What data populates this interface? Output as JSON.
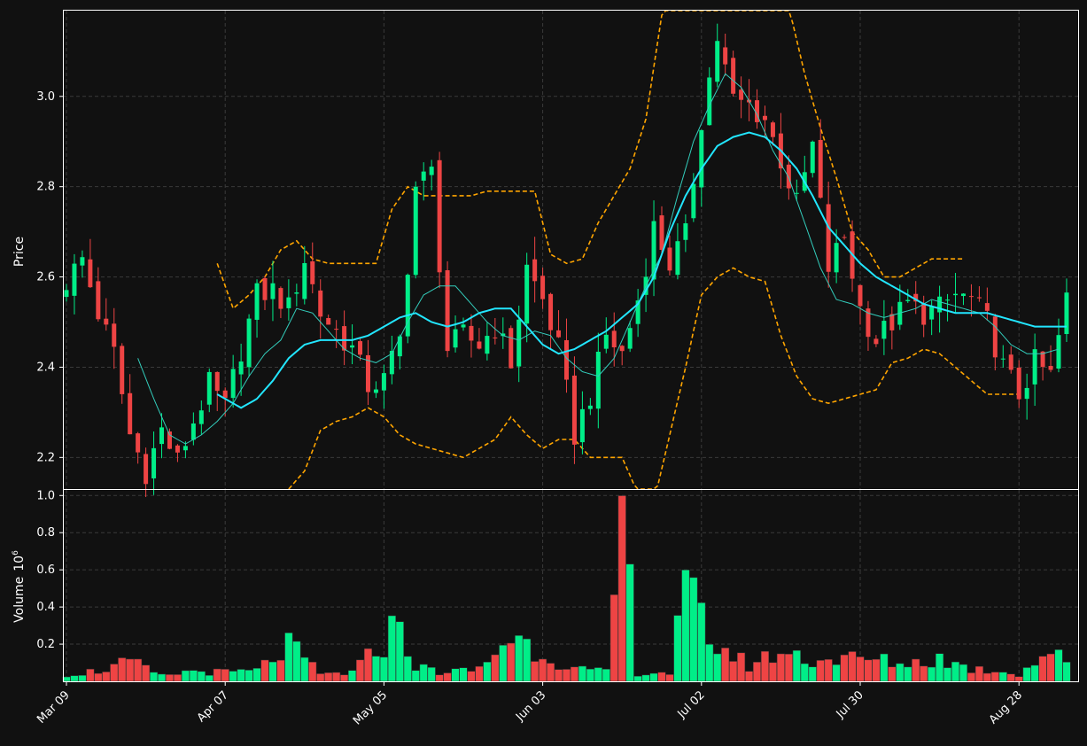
{
  "chart_data": {
    "type": "candlestick",
    "x_tick_labels": [
      "Mar 09",
      "Apr 07",
      "May 05",
      "Jun 03",
      "Jul 02",
      "Jul 30",
      "Aug 28"
    ],
    "x_tick_index": [
      0,
      20,
      40,
      60,
      80,
      100,
      120
    ],
    "price_panel": {
      "ylabel": "Price",
      "ylim": [
        2.13,
        3.19
      ],
      "yticks": [
        2.2,
        2.4,
        2.6,
        2.8,
        3.0
      ],
      "grid": true
    },
    "volume_panel": {
      "ylabel": "Volume",
      "ylabel_exponent": "10",
      "ylabel_exponent_power": "6",
      "ylim": [
        0,
        1.03
      ],
      "yticks": [
        0.2,
        0.4,
        0.6,
        0.8,
        1.0
      ],
      "tick_labels": [
        "0.2",
        "0.4",
        "0.6",
        "0.8",
        "1.0"
      ],
      "grid": true
    },
    "colors": {
      "background": "#111111",
      "up": "#00ee88",
      "down": "#ee4444",
      "bollinger": "#ffa500",
      "ma_slow": "#22e6ff",
      "ma_fast": "#33ccbb",
      "grid": "#3a3a3a",
      "axis": "#ffffff"
    },
    "anchors": {
      "close": [
        [
          0,
          2.59
        ],
        [
          2,
          2.64
        ],
        [
          4,
          2.52
        ],
        [
          6,
          2.43
        ],
        [
          8,
          2.25
        ],
        [
          10,
          2.17
        ],
        [
          12,
          2.26
        ],
        [
          14,
          2.19
        ],
        [
          16,
          2.28
        ],
        [
          18,
          2.36
        ],
        [
          20,
          2.31
        ],
        [
          22,
          2.44
        ],
        [
          24,
          2.56
        ],
        [
          26,
          2.57
        ],
        [
          28,
          2.53
        ],
        [
          30,
          2.64
        ],
        [
          32,
          2.52
        ],
        [
          34,
          2.48
        ],
        [
          36,
          2.44
        ],
        [
          38,
          2.36
        ],
        [
          40,
          2.37
        ],
        [
          42,
          2.46
        ],
        [
          44,
          2.8
        ],
        [
          46,
          2.83
        ],
        [
          48,
          2.44
        ],
        [
          50,
          2.47
        ],
        [
          52,
          2.45
        ],
        [
          54,
          2.49
        ],
        [
          56,
          2.41
        ],
        [
          58,
          2.62
        ],
        [
          60,
          2.55
        ],
        [
          62,
          2.44
        ],
        [
          64,
          2.25
        ],
        [
          66,
          2.34
        ],
        [
          68,
          2.47
        ],
        [
          70,
          2.43
        ],
        [
          72,
          2.55
        ],
        [
          74,
          2.71
        ],
        [
          76,
          2.63
        ],
        [
          78,
          2.69
        ],
        [
          80,
          2.95
        ],
        [
          82,
          3.13
        ],
        [
          84,
          2.99
        ],
        [
          86,
          2.98
        ],
        [
          88,
          2.95
        ],
        [
          90,
          2.86
        ],
        [
          92,
          2.76
        ],
        [
          94,
          2.89
        ],
        [
          96,
          2.62
        ],
        [
          98,
          2.69
        ],
        [
          100,
          2.53
        ],
        [
          102,
          2.46
        ],
        [
          104,
          2.5
        ],
        [
          106,
          2.54
        ],
        [
          108,
          2.52
        ],
        [
          110,
          2.53
        ],
        [
          112,
          2.56
        ],
        [
          114,
          2.55
        ],
        [
          116,
          2.5
        ],
        [
          118,
          2.4
        ],
        [
          120,
          2.34
        ],
        [
          122,
          2.41
        ],
        [
          124,
          2.38
        ],
        [
          126,
          2.55
        ]
      ],
      "ma_slow": [
        [
          19,
          2.34
        ],
        [
          22,
          2.31
        ],
        [
          24,
          2.33
        ],
        [
          26,
          2.37
        ],
        [
          28,
          2.42
        ],
        [
          30,
          2.45
        ],
        [
          32,
          2.46
        ],
        [
          34,
          2.46
        ],
        [
          36,
          2.46
        ],
        [
          38,
          2.47
        ],
        [
          40,
          2.49
        ],
        [
          42,
          2.51
        ],
        [
          44,
          2.52
        ],
        [
          46,
          2.5
        ],
        [
          48,
          2.49
        ],
        [
          50,
          2.5
        ],
        [
          52,
          2.52
        ],
        [
          54,
          2.53
        ],
        [
          56,
          2.53
        ],
        [
          58,
          2.49
        ],
        [
          60,
          2.45
        ],
        [
          62,
          2.43
        ],
        [
          64,
          2.44
        ],
        [
          66,
          2.46
        ],
        [
          68,
          2.48
        ],
        [
          70,
          2.51
        ],
        [
          72,
          2.54
        ],
        [
          74,
          2.6
        ],
        [
          76,
          2.7
        ],
        [
          78,
          2.78
        ],
        [
          80,
          2.84
        ],
        [
          82,
          2.89
        ],
        [
          84,
          2.91
        ],
        [
          86,
          2.92
        ],
        [
          88,
          2.91
        ],
        [
          90,
          2.88
        ],
        [
          92,
          2.84
        ],
        [
          94,
          2.78
        ],
        [
          96,
          2.71
        ],
        [
          98,
          2.67
        ],
        [
          100,
          2.63
        ],
        [
          102,
          2.6
        ],
        [
          104,
          2.58
        ],
        [
          106,
          2.56
        ],
        [
          108,
          2.54
        ],
        [
          110,
          2.53
        ],
        [
          112,
          2.52
        ],
        [
          114,
          2.52
        ],
        [
          116,
          2.52
        ],
        [
          118,
          2.51
        ],
        [
          120,
          2.5
        ],
        [
          122,
          2.49
        ],
        [
          124,
          2.49
        ],
        [
          126,
          2.49
        ]
      ],
      "ma_fast": [
        [
          9,
          2.42
        ],
        [
          11,
          2.33
        ],
        [
          13,
          2.25
        ],
        [
          15,
          2.23
        ],
        [
          17,
          2.25
        ],
        [
          19,
          2.28
        ],
        [
          21,
          2.32
        ],
        [
          23,
          2.38
        ],
        [
          25,
          2.43
        ],
        [
          27,
          2.46
        ],
        [
          29,
          2.53
        ],
        [
          31,
          2.52
        ],
        [
          33,
          2.48
        ],
        [
          35,
          2.44
        ],
        [
          37,
          2.42
        ],
        [
          39,
          2.41
        ],
        [
          41,
          2.43
        ],
        [
          43,
          2.5
        ],
        [
          45,
          2.56
        ],
        [
          47,
          2.58
        ],
        [
          49,
          2.58
        ],
        [
          51,
          2.54
        ],
        [
          53,
          2.5
        ],
        [
          55,
          2.47
        ],
        [
          57,
          2.46
        ],
        [
          59,
          2.48
        ],
        [
          61,
          2.47
        ],
        [
          63,
          2.42
        ],
        [
          65,
          2.39
        ],
        [
          67,
          2.38
        ],
        [
          69,
          2.42
        ],
        [
          71,
          2.5
        ],
        [
          73,
          2.58
        ],
        [
          75,
          2.65
        ],
        [
          77,
          2.78
        ],
        [
          79,
          2.9
        ],
        [
          81,
          2.98
        ],
        [
          83,
          3.05
        ],
        [
          85,
          3.02
        ],
        [
          87,
          2.96
        ],
        [
          89,
          2.88
        ],
        [
          91,
          2.82
        ],
        [
          93,
          2.72
        ],
        [
          95,
          2.62
        ],
        [
          97,
          2.55
        ],
        [
          99,
          2.54
        ],
        [
          101,
          2.52
        ],
        [
          103,
          2.51
        ],
        [
          105,
          2.52
        ],
        [
          107,
          2.53
        ],
        [
          109,
          2.55
        ],
        [
          111,
          2.54
        ],
        [
          113,
          2.53
        ],
        [
          115,
          2.52
        ],
        [
          117,
          2.49
        ],
        [
          119,
          2.45
        ],
        [
          121,
          2.43
        ],
        [
          123,
          2.43
        ],
        [
          125,
          2.44
        ]
      ],
      "bb_upper": [
        [
          19,
          2.63
        ],
        [
          21,
          2.53
        ],
        [
          23,
          2.56
        ],
        [
          25,
          2.6
        ],
        [
          27,
          2.66
        ],
        [
          29,
          2.68
        ],
        [
          31,
          2.64
        ],
        [
          33,
          2.63
        ],
        [
          35,
          2.63
        ],
        [
          37,
          2.63
        ],
        [
          39,
          2.63
        ],
        [
          41,
          2.75
        ],
        [
          43,
          2.8
        ],
        [
          45,
          2.78
        ],
        [
          47,
          2.78
        ],
        [
          49,
          2.78
        ],
        [
          51,
          2.78
        ],
        [
          53,
          2.79
        ],
        [
          55,
          2.79
        ],
        [
          57,
          2.79
        ],
        [
          59,
          2.79
        ],
        [
          61,
          2.65
        ],
        [
          63,
          2.63
        ],
        [
          65,
          2.64
        ],
        [
          67,
          2.72
        ],
        [
          69,
          2.78
        ],
        [
          71,
          2.84
        ],
        [
          73,
          2.95
        ],
        [
          75,
          3.18
        ],
        [
          77,
          3.3
        ],
        [
          79,
          3.4
        ],
        [
          81,
          3.45
        ],
        [
          83,
          3.4
        ],
        [
          85,
          3.35
        ],
        [
          87,
          3.3
        ],
        [
          89,
          3.25
        ],
        [
          91,
          3.2
        ],
        [
          93,
          3.05
        ],
        [
          95,
          2.93
        ],
        [
          97,
          2.82
        ],
        [
          99,
          2.7
        ],
        [
          101,
          2.66
        ],
        [
          103,
          2.6
        ],
        [
          105,
          2.6
        ],
        [
          107,
          2.62
        ],
        [
          109,
          2.64
        ],
        [
          111,
          2.64
        ],
        [
          113,
          2.64
        ]
      ],
      "bb_lower": [
        [
          28,
          2.13
        ],
        [
          30,
          2.17
        ],
        [
          32,
          2.26
        ],
        [
          34,
          2.28
        ],
        [
          36,
          2.29
        ],
        [
          38,
          2.31
        ],
        [
          40,
          2.29
        ],
        [
          42,
          2.25
        ],
        [
          44,
          2.23
        ],
        [
          46,
          2.22
        ],
        [
          48,
          2.21
        ],
        [
          50,
          2.2
        ],
        [
          52,
          2.22
        ],
        [
          54,
          2.24
        ],
        [
          56,
          2.29
        ],
        [
          58,
          2.25
        ],
        [
          60,
          2.22
        ],
        [
          62,
          2.24
        ],
        [
          64,
          2.24
        ],
        [
          66,
          2.2
        ],
        [
          68,
          2.2
        ],
        [
          70,
          2.2
        ],
        [
          72,
          2.12
        ],
        [
          74,
          2.1
        ],
        [
          76,
          2.25
        ],
        [
          78,
          2.4
        ],
        [
          80,
          2.56
        ],
        [
          82,
          2.6
        ],
        [
          84,
          2.62
        ],
        [
          86,
          2.6
        ],
        [
          88,
          2.59
        ],
        [
          90,
          2.47
        ],
        [
          92,
          2.38
        ],
        [
          94,
          2.33
        ],
        [
          96,
          2.32
        ],
        [
          98,
          2.33
        ],
        [
          100,
          2.34
        ],
        [
          102,
          2.35
        ],
        [
          104,
          2.41
        ],
        [
          106,
          2.42
        ],
        [
          108,
          2.44
        ],
        [
          110,
          2.43
        ],
        [
          112,
          2.4
        ],
        [
          114,
          2.37
        ],
        [
          116,
          2.34
        ],
        [
          118,
          2.34
        ],
        [
          120,
          2.34
        ]
      ],
      "volume_m": [
        [
          0,
          0.04
        ],
        [
          4,
          0.06
        ],
        [
          8,
          0.11
        ],
        [
          12,
          0.03
        ],
        [
          16,
          0.06
        ],
        [
          20,
          0.05
        ],
        [
          24,
          0.06
        ],
        [
          28,
          0.2
        ],
        [
          32,
          0.04
        ],
        [
          36,
          0.05
        ],
        [
          40,
          0.22
        ],
        [
          42,
          0.35
        ],
        [
          44,
          0.08
        ],
        [
          48,
          0.05
        ],
        [
          52,
          0.07
        ],
        [
          56,
          0.26
        ],
        [
          60,
          0.16
        ],
        [
          64,
          0.07
        ],
        [
          68,
          0.05
        ],
        [
          70,
          0.95
        ],
        [
          72,
          0.05
        ],
        [
          76,
          0.05
        ],
        [
          78,
          0.5
        ],
        [
          79,
          0.42
        ],
        [
          82,
          0.2
        ],
        [
          86,
          0.09
        ],
        [
          90,
          0.17
        ],
        [
          94,
          0.12
        ],
        [
          98,
          0.13
        ],
        [
          102,
          0.12
        ],
        [
          106,
          0.1
        ],
        [
          110,
          0.13
        ],
        [
          114,
          0.07
        ],
        [
          118,
          0.06
        ],
        [
          120,
          0.04
        ],
        [
          124,
          0.18
        ],
        [
          126,
          0.09
        ]
      ]
    }
  }
}
